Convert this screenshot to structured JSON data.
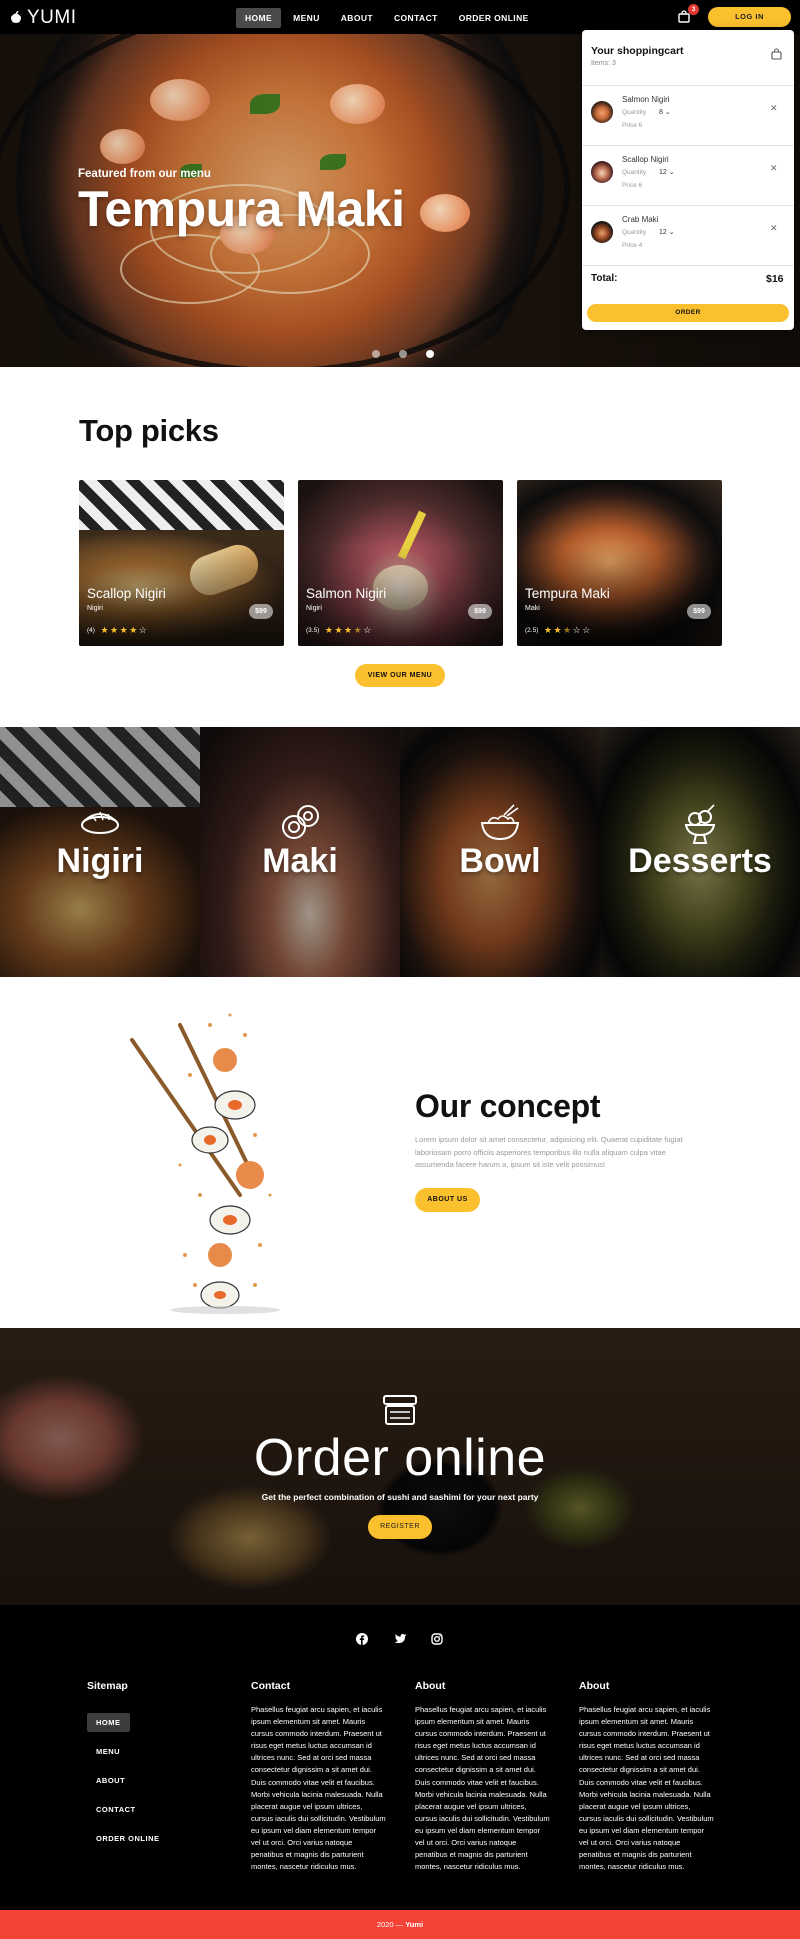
{
  "header": {
    "logo_text": "YUMI",
    "nav": [
      "HOME",
      "MENU",
      "ABOUT",
      "CONTACT",
      "ORDER ONLINE"
    ],
    "cart_badge": "3",
    "login_label": "LOG IN"
  },
  "hero": {
    "subtitle": "Featured from our menu",
    "title": "Tempura Maki"
  },
  "cart": {
    "title": "Your shoppingcart",
    "count": "Items: 3",
    "items": [
      {
        "name": "Salmon Nigiri",
        "qty_label": "Quantity",
        "qty": "8",
        "price": "Price 6"
      },
      {
        "name": "Scallop Nigiri",
        "qty_label": "Quantity",
        "qty": "12",
        "price": "Price 6"
      },
      {
        "name": "Crab Maki",
        "qty_label": "Quantity",
        "qty": "12",
        "price": "Price 4"
      }
    ],
    "total_label": "Total:",
    "total": "$16",
    "order_label": "ORDER"
  },
  "top_picks": {
    "title": "Top picks",
    "cards": [
      {
        "name": "Scallop Nigiri",
        "category": "Nigiri",
        "rating_count": "(4)",
        "rating": 4,
        "price": "$99"
      },
      {
        "name": "Salmon Nigiri",
        "category": "Nigiri",
        "rating_count": "(3.5)",
        "rating": 3.5,
        "price": "$99"
      },
      {
        "name": "Tempura Maki",
        "category": "Maki",
        "rating_count": "(2.5)",
        "rating": 2.5,
        "price": "$99"
      }
    ],
    "button": "VIEW OUR MENU"
  },
  "categories": [
    {
      "label": "Nigiri",
      "icon": "nigiri-icon"
    },
    {
      "label": "Maki",
      "icon": "maki-icon"
    },
    {
      "label": "Bowl",
      "icon": "bowl-icon"
    },
    {
      "label": "Desserts",
      "icon": "dessert-icon"
    }
  ],
  "concept": {
    "title": "Our concept",
    "text": "Lorem ipsum dolor sit amet consectetur, adipisicing elit. Quaerat cupiditate fugiat laboriosam porro officiis asperiores temporibus illo nulla aliquam culpa vitae assumenda facere harum a, ipsum sit iste velit possimus!",
    "button": "ABOUT US"
  },
  "order_online": {
    "title": "Order online",
    "subtitle": "Get the perfect combination of sushi and sashimi for your next party",
    "button": "REGISTER"
  },
  "footer": {
    "sitemap_title": "Sitemap",
    "sitemap": [
      "HOME",
      "MENU",
      "ABOUT",
      "CONTACT",
      "ORDER ONLINE"
    ],
    "columns": [
      {
        "title": "Contact",
        "text": "Phasellus feugiat arcu sapien, et iaculis ipsum elementum sit amet. Mauris cursus commodo interdum. Praesent ut risus eget metus luctus accumsan id ultrices nunc. Sed at orci sed massa consectetur dignissim a sit amet dui. Duis commodo vitae velit et faucibus. Morbi vehicula lacinia malesuada. Nulla placerat augue vel ipsum ultrices, cursus iaculis dui sollicitudin. Vestibulum eu ipsum vel diam elementum tempor vel ut orci. Orci varius natoque penatibus et magnis dis parturient montes, nascetur ridiculus mus."
      },
      {
        "title": "About",
        "text": "Phasellus feugiat arcu sapien, et iaculis ipsum elementum sit amet. Mauris cursus commodo interdum. Praesent ut risus eget metus luctus accumsan id ultrices nunc. Sed at orci sed massa consectetur dignissim a sit amet dui. Duis commodo vitae velit et faucibus. Morbi vehicula lacinia malesuada. Nulla placerat augue vel ipsum ultrices, cursus iaculis dui sollicitudin. Vestibulum eu ipsum vel diam elementum tempor vel ut orci. Orci varius natoque penatibus et magnis dis parturient montes, nascetur ridiculus mus."
      },
      {
        "title": "About",
        "text": "Phasellus feugiat arcu sapien, et iaculis ipsum elementum sit amet. Mauris cursus commodo interdum. Praesent ut risus eget metus luctus accumsan id ultrices nunc. Sed at orci sed massa consectetur dignissim a sit amet dui. Duis commodo vitae velit et faucibus. Morbi vehicula lacinia malesuada. Nulla placerat augue vel ipsum ultrices, cursus iaculis dui sollicitudin. Vestibulum eu ipsum vel diam elementum tempor vel ut orci. Orci varius natoque penatibus et magnis dis parturient montes, nascetur ridiculus mus."
      }
    ],
    "social": [
      "facebook-icon",
      "twitter-icon",
      "instagram-icon"
    ],
    "copyright_year": "2020 —",
    "copyright_name": "Yumi"
  },
  "colors": {
    "accent": "#fbc02d",
    "header": "#000000",
    "bottom_bar": "#f44336",
    "badge": "#e53935"
  }
}
